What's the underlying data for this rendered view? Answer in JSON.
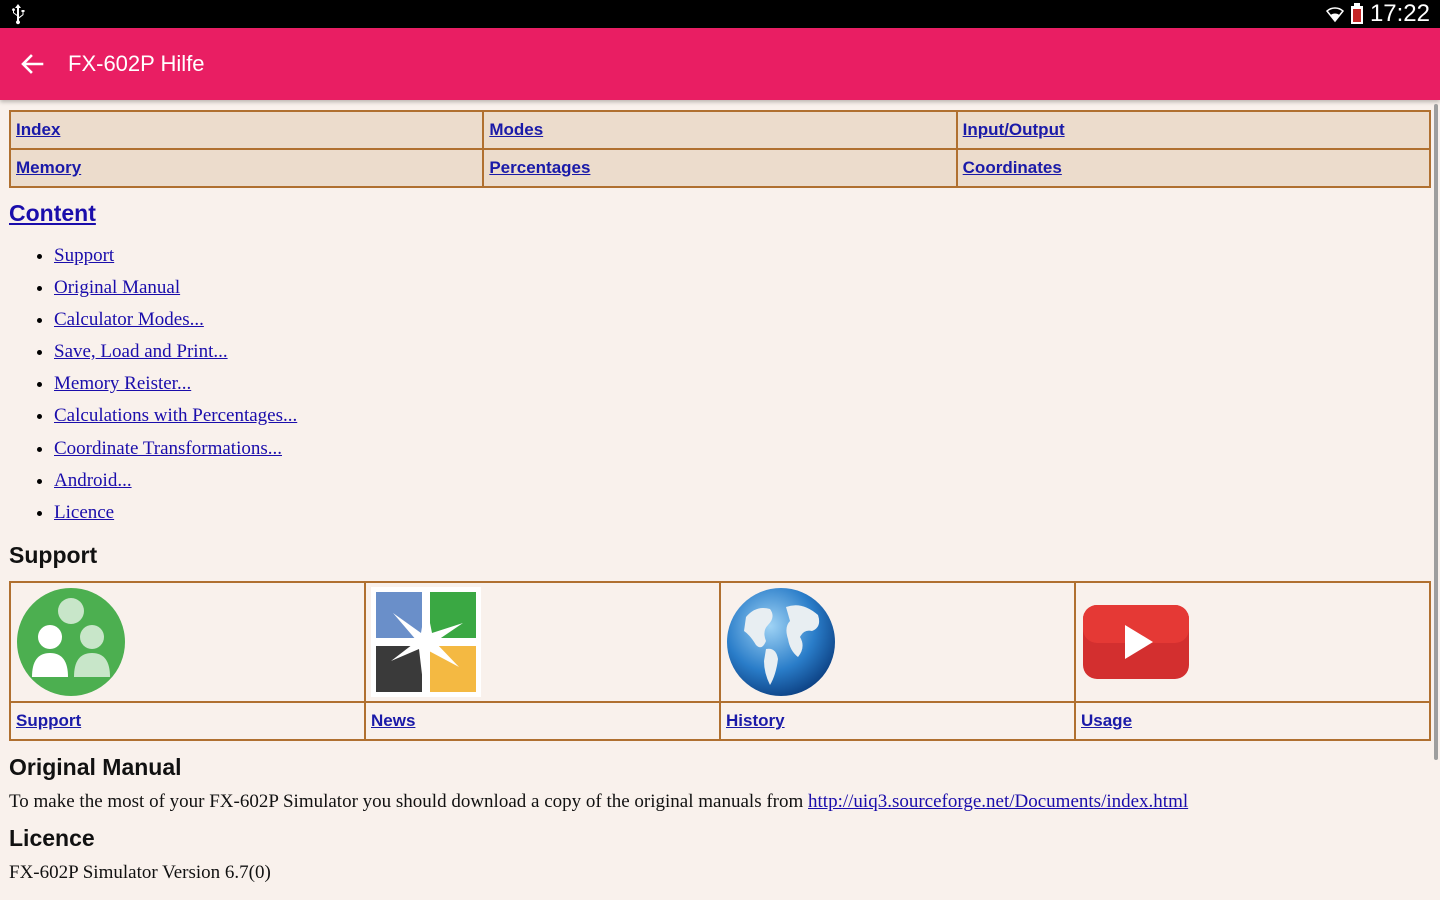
{
  "status_bar": {
    "time": "17:22"
  },
  "app_bar": {
    "title": "FX-602P Hilfe"
  },
  "nav_table": [
    [
      "Index",
      "Modes",
      "Input/Output"
    ],
    [
      "Memory",
      "Percentages",
      "Coordinates"
    ]
  ],
  "content": {
    "heading": "Content",
    "items": [
      "Support",
      "Original Manual",
      "Calculator Modes...",
      "Save, Load and Print...",
      "Memory Reister...",
      "Calculations with Percentages...",
      "Coordinate Transformations...",
      "Android...",
      "Licence"
    ]
  },
  "support": {
    "heading": "Support",
    "tiles": [
      {
        "label": "Support",
        "icon": "support-people-icon"
      },
      {
        "label": "News",
        "icon": "news-squares-icon"
      },
      {
        "label": "History",
        "icon": "globe-icon"
      },
      {
        "label": "Usage",
        "icon": "youtube-play-icon"
      }
    ]
  },
  "original_manual": {
    "heading": "Original Manual",
    "text": "To make the most of your FX-602P Simulator you should download a copy of the original manuals from ",
    "link": "http://uiq3.sourceforge.net/Documents/index.html"
  },
  "licence": {
    "heading": "Licence",
    "text": "FX-602P Simulator Version 6.7(0)"
  },
  "colors": {
    "app_bar": "#e91e63",
    "table_border": "#b07030",
    "table_cell": "#ecdccc",
    "page_bg": "#f9f1ec"
  }
}
